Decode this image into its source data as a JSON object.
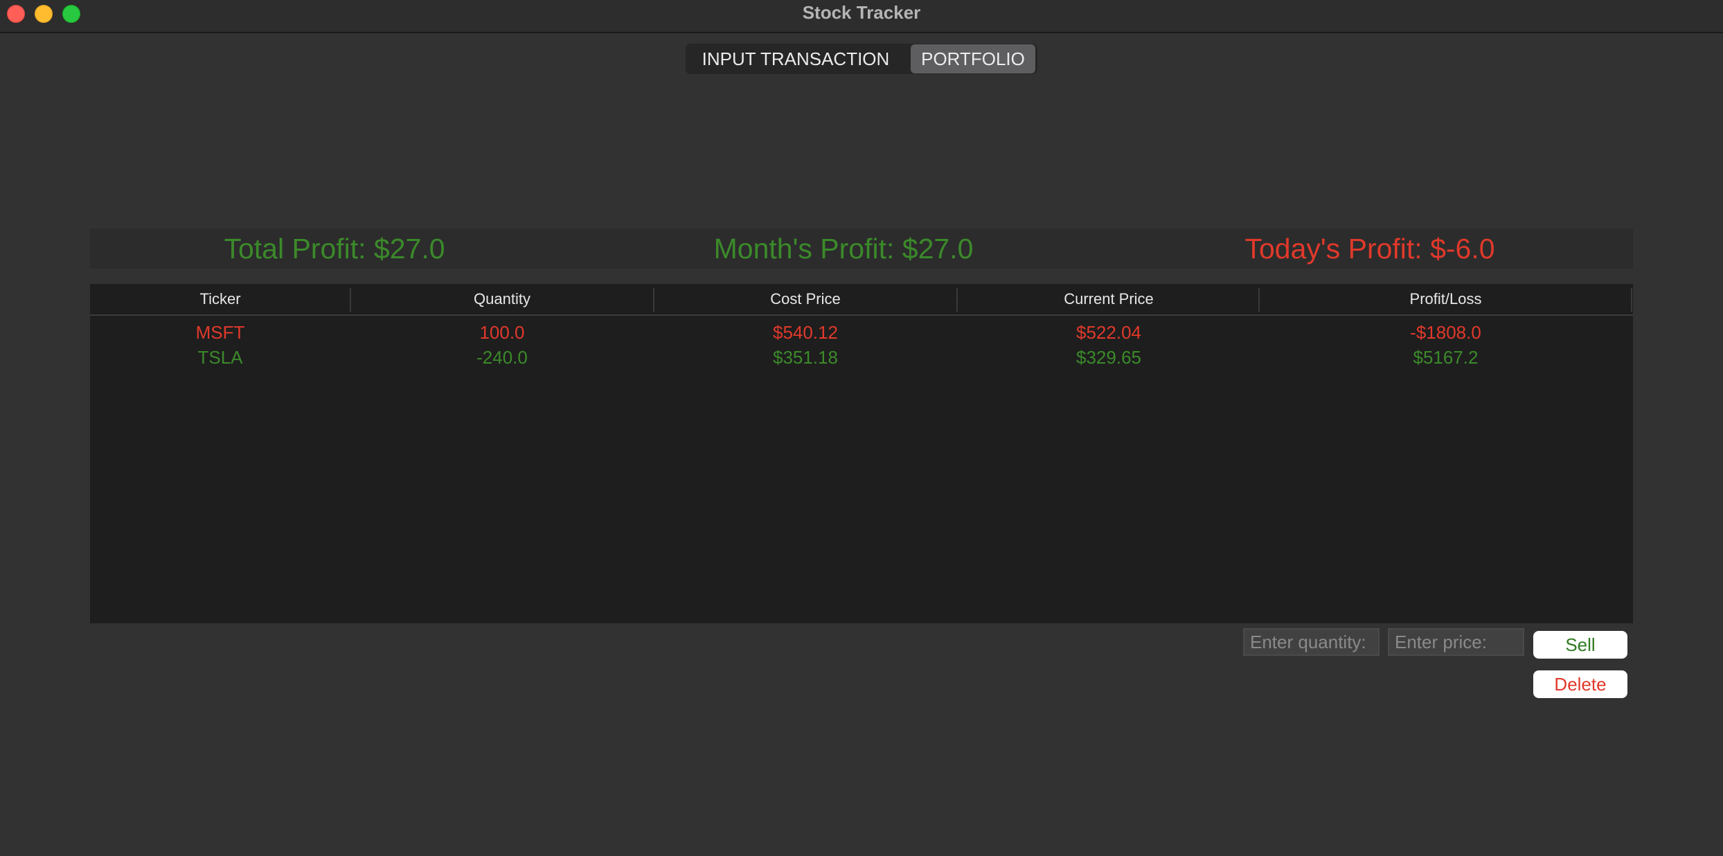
{
  "window": {
    "title": "Stock Tracker"
  },
  "tabs": [
    {
      "label": "INPUT TRANSACTION",
      "selected": false
    },
    {
      "label": "PORTFOLIO",
      "selected": true
    }
  ],
  "profits": {
    "total": "Total Profit: $27.0",
    "month": "Month's Profit: $27.0",
    "today": "Today's Profit: $-6.0"
  },
  "table": {
    "columns": [
      "Ticker",
      "Quantity",
      "Cost Price",
      "Current Price",
      "Profit/Loss"
    ],
    "rows": [
      {
        "ticker": "MSFT",
        "quantity": "100.0",
        "cost_price": "$540.12",
        "current_price": "$522.04",
        "profit_loss": "-$1808.0",
        "status": "loss"
      },
      {
        "ticker": "TSLA",
        "quantity": "-240.0",
        "cost_price": "$351.18",
        "current_price": "$329.65",
        "profit_loss": "$5167.2",
        "status": "gain"
      }
    ]
  },
  "controls": {
    "quantity_placeholder": "Enter quantity:",
    "price_placeholder": "Enter price:",
    "sell_label": "Sell",
    "delete_label": "Delete"
  },
  "colors": {
    "gain": "#3b8a2a",
    "loss": "#e0392b",
    "background": "#323232",
    "table_background": "#1e1e1e"
  }
}
